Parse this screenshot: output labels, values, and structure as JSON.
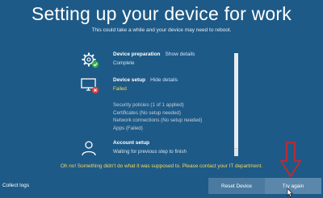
{
  "header": {
    "title": "Setting up your device for work",
    "subtitle": "This could take a while and your device may need to reboot."
  },
  "steps": [
    {
      "name": "Device preparation",
      "link": "Show details",
      "status": "Complete",
      "icon": "gear-icon",
      "badge": "check-badge-icon"
    },
    {
      "name": "Device setup",
      "link": "Hide details",
      "status": "Failed",
      "icon": "monitor-icon",
      "badge": "error-badge-icon",
      "details": [
        "Security policies (1 of 1 applied)",
        "Certificates (No setup needed)",
        "Network connections (No setup needed)",
        "Apps (Failed)"
      ]
    },
    {
      "name": "Account setup",
      "status": "Waiting for previous step to finish",
      "icon": "user-icon"
    }
  ],
  "warning": "Oh no! Something didn't do what it was supposed to. Please contact your IT department.",
  "footer": {
    "collect_logs": "Collect logs",
    "reset_button": "Reset Device",
    "try_again_button": "Try again"
  },
  "colors": {
    "background": "#1e5a87",
    "warning": "#f5d85a",
    "success": "#2fb344",
    "error": "#e23b3b",
    "annotation_arrow": "#e02020"
  }
}
